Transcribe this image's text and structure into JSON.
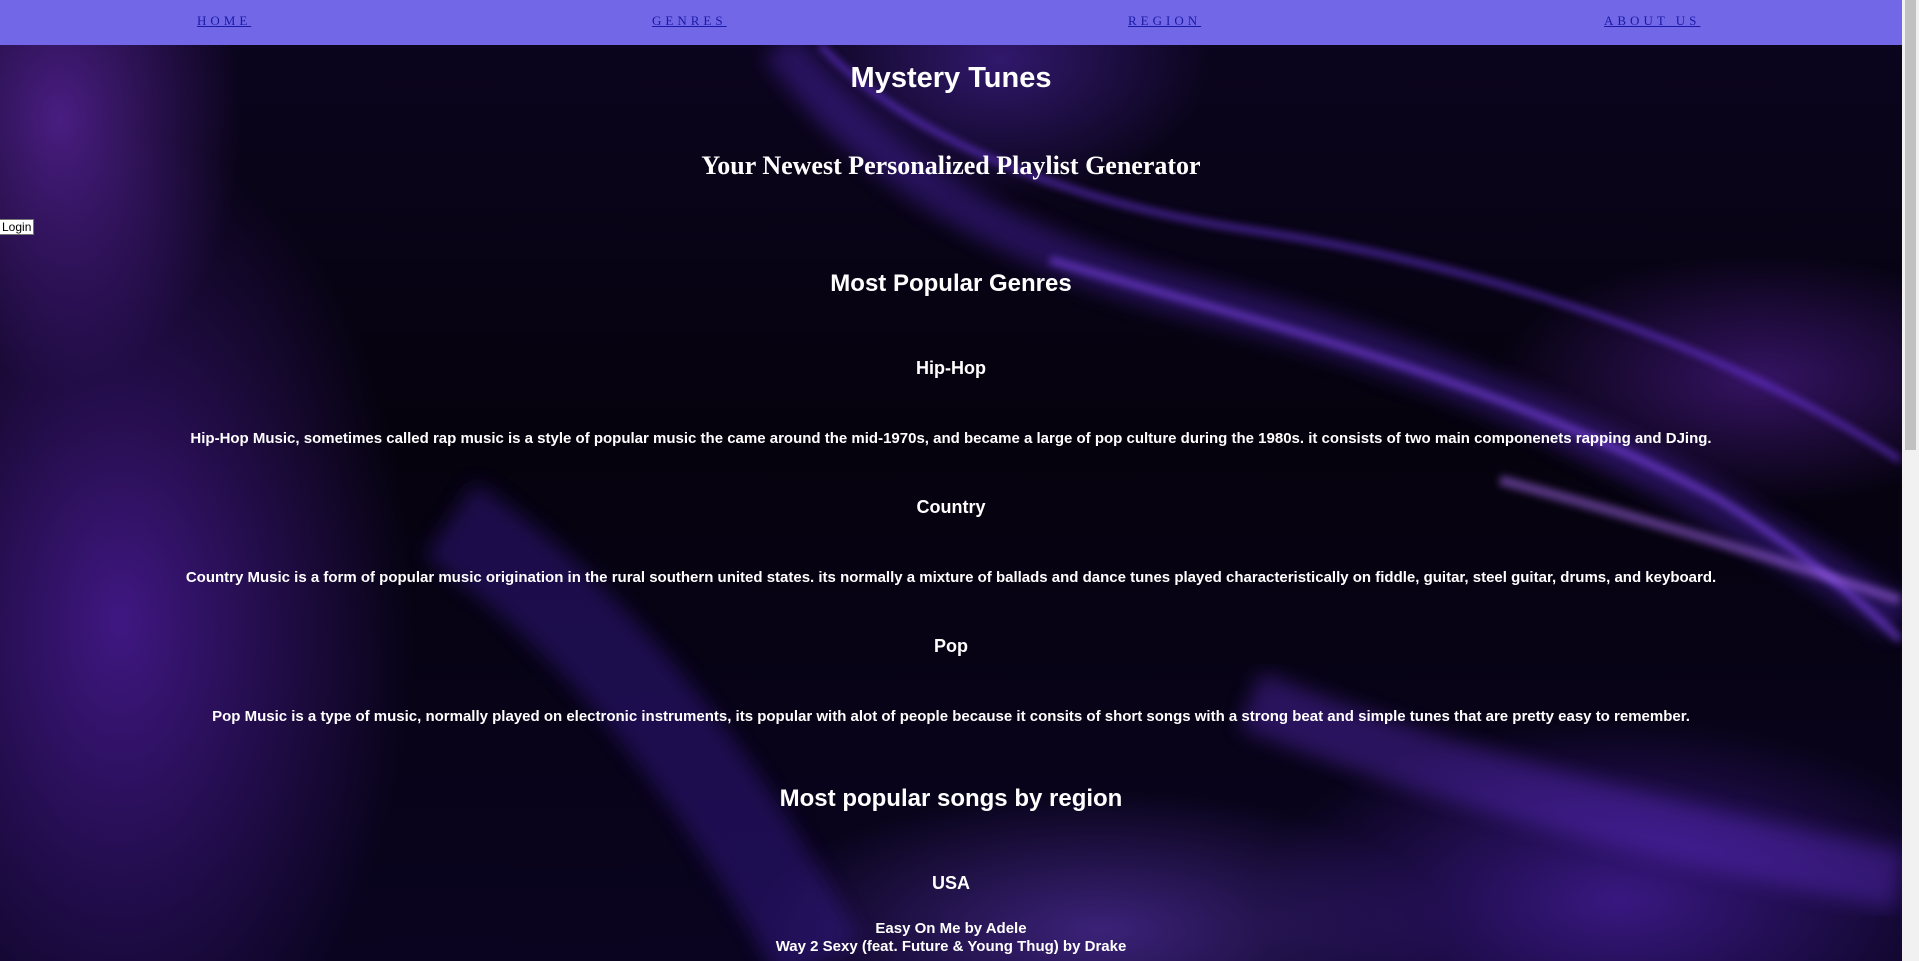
{
  "nav": {
    "home": "HOME",
    "genres": "GENRES",
    "region": "REGION",
    "about": "ABOUT US"
  },
  "login_label": "Login",
  "header": {
    "title": "Mystery Tunes",
    "subtitle": "Your Newest Personalized Playlist Generator"
  },
  "genres_section": {
    "heading": "Most Popular Genres",
    "items": [
      {
        "name": "Hip-Hop",
        "description": "Hip-Hop Music, sometimes called rap music is a style of popular music the came around the mid-1970s, and became a large of pop culture during the 1980s. it consists of two main componenets rapping and DJing."
      },
      {
        "name": "Country",
        "description": "Country Music is a form of popular music origination in the rural southern united states. its normally a mixture of ballads and dance tunes played characteristically on fiddle, guitar, steel guitar, drums, and keyboard."
      },
      {
        "name": "Pop",
        "description": "Pop Music is a type of music, normally played on electronic instruments, its popular with alot of people because it consits of short songs with a strong beat and simple tunes that are pretty easy to remember."
      }
    ]
  },
  "region_section": {
    "heading": "Most popular songs by region",
    "region_name": "USA",
    "songs": [
      "Easy On Me by Adele",
      "Way 2 Sexy (feat. Future & Young Thug) by Drake"
    ]
  },
  "colors": {
    "navbar": "#7267e6",
    "nav_link": "#1a1aa8",
    "text": "#ffffff",
    "background_accent": "#6a2ee0"
  }
}
